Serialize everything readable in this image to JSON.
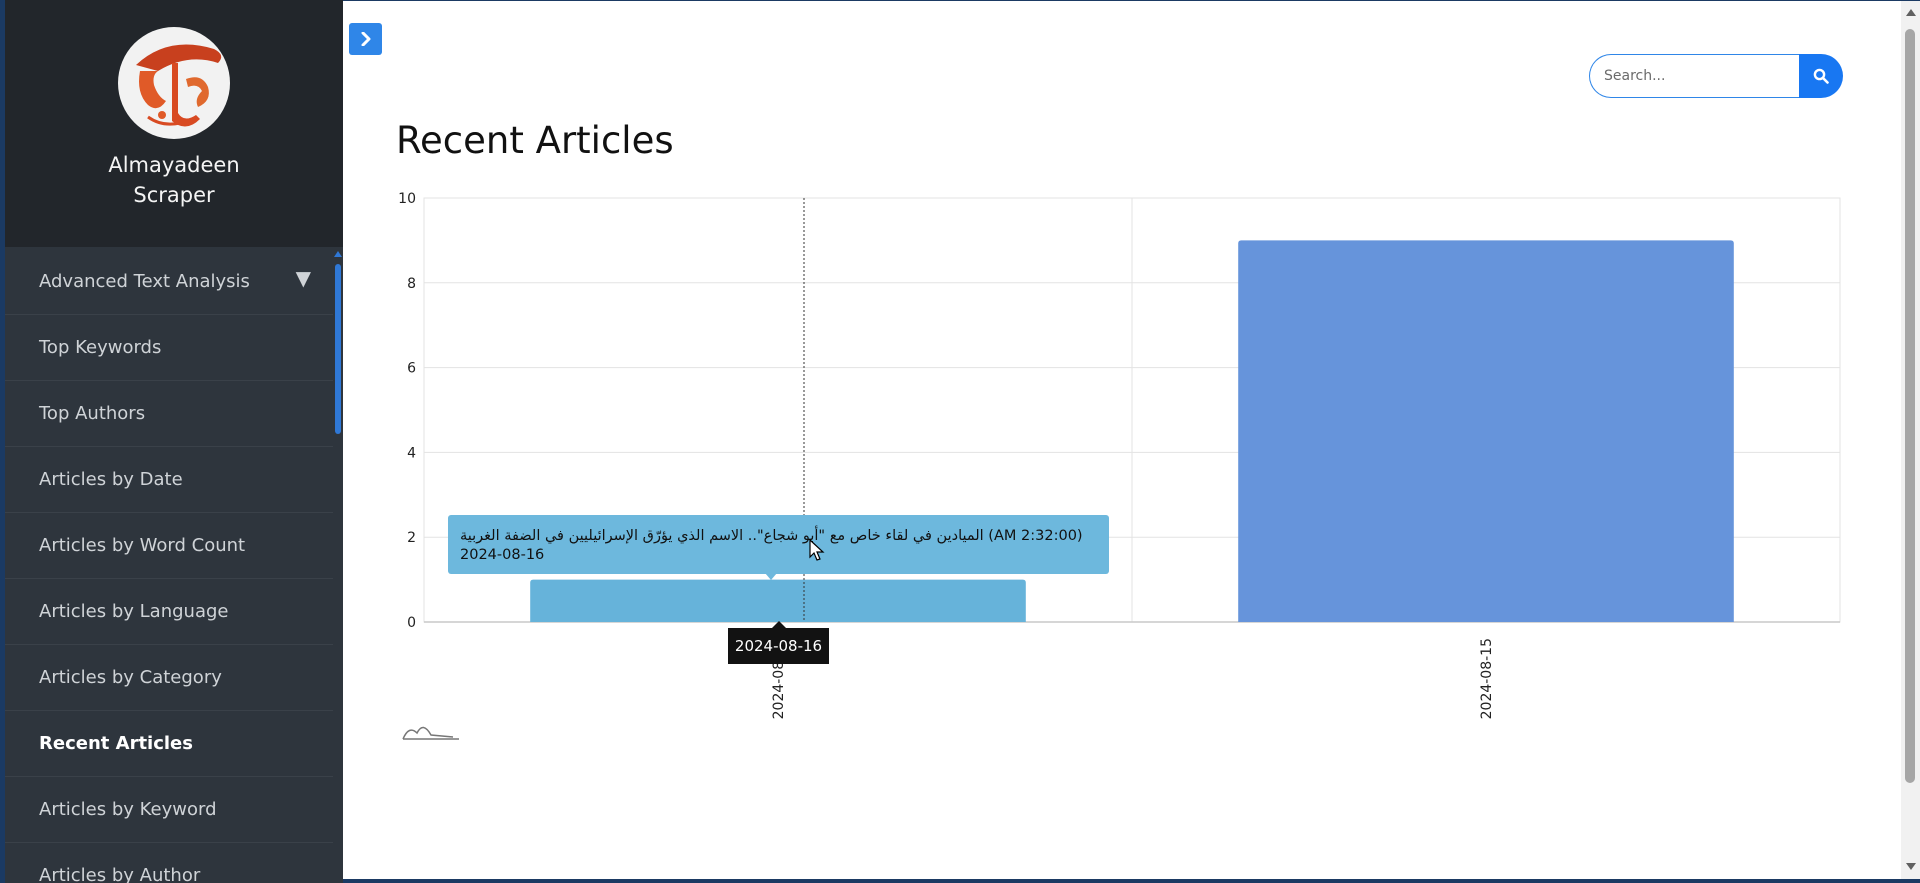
{
  "sidebar": {
    "brand_line1": "Almayadeen",
    "brand_line2": "Scraper",
    "items": [
      {
        "label": "Advanced Text Analysis",
        "expandable": true
      },
      {
        "label": "Top Keywords"
      },
      {
        "label": "Top Authors"
      },
      {
        "label": "Articles by Date"
      },
      {
        "label": "Articles by Word Count"
      },
      {
        "label": "Articles by Language"
      },
      {
        "label": "Articles by Category"
      },
      {
        "label": "Recent Articles",
        "active": true
      },
      {
        "label": "Articles by Keyword"
      },
      {
        "label": "Articles by Author"
      }
    ]
  },
  "search": {
    "placeholder": "Search..."
  },
  "page": {
    "title": "Recent Articles"
  },
  "colors": {
    "sidebar_bg": "#2e353d",
    "sidebar_header_bg": "#22262b",
    "accent": "#1877f2",
    "bar_1": "#66b3da",
    "bar_2": "#6694db"
  },
  "tooltip": {
    "line1": "(2:32:00 AM) الميادين في لقاء خاص مع \"أبو شجاع\".. الاسم الذي يؤرّق الإسرائيليين في الضفة الغربية",
    "line2": "2024-08-16"
  },
  "axis_tooltip": "2024-08-16",
  "chart_data": {
    "type": "bar",
    "categories": [
      "2024-08-16",
      "2024-08-15"
    ],
    "values": [
      1,
      9
    ],
    "colors": [
      "#66b3da",
      "#6694db"
    ],
    "ylim": [
      0,
      10
    ],
    "yticks": [
      0,
      2,
      4,
      6,
      8,
      10
    ],
    "grid": true,
    "legend": "none",
    "title": "",
    "xlabel": "",
    "ylabel": ""
  }
}
